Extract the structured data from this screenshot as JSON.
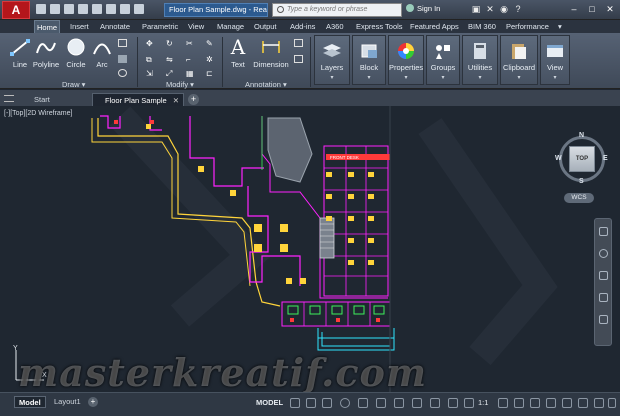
{
  "title_bar": {
    "app_logo": "A",
    "doc_title": "Floor Plan Sample.dwg - Read...",
    "search_placeholder": "Type a keyword or phrase",
    "signin_label": "Sign In"
  },
  "ribbon_tabs": [
    "Home",
    "Insert",
    "Annotate",
    "Parametric",
    "View",
    "Manage",
    "Output",
    "Add-ins",
    "A360",
    "Express Tools",
    "Featured Apps",
    "BIM 360",
    "Performance"
  ],
  "active_tab": "Home",
  "ribbon": {
    "draw_tools": [
      "Line",
      "Polyline",
      "Circle",
      "Arc"
    ],
    "draw_label": "Draw",
    "modify_label": "Modify",
    "annotation_tools": [
      "Text",
      "Dimension"
    ],
    "annotation_label": "Annotation",
    "groups": [
      "Layers",
      "Block",
      "Properties",
      "Groups",
      "Utilities",
      "Clipboard",
      "View"
    ]
  },
  "file_tabs": [
    "Start",
    "Floor Plan Sample"
  ],
  "active_file": "Floor Plan Sample",
  "viewport_label": "[-][Top][2D Wireframe]",
  "viewcube": {
    "face": "TOP",
    "n": "N",
    "s": "S",
    "e": "E",
    "w": "W",
    "wcs": "WCS"
  },
  "ucs": {
    "x": "X",
    "y": "Y"
  },
  "watermark": "masterkreatif.com",
  "drawing_tag": "FRONT DESK",
  "layout_tabs": [
    "Model",
    "Layout1"
  ],
  "active_layout": "Model",
  "statusbar": {
    "model": "MODEL",
    "scale": "1:1"
  },
  "colors": {
    "magenta": "#ff22ff",
    "yellow": "#ffd43b",
    "cyan": "#2fe6ff",
    "green": "#3cf05a",
    "red": "#ff3a3a",
    "white": "#f2f2f2",
    "canvas": "#1f2731",
    "accent": "#b4161b"
  }
}
